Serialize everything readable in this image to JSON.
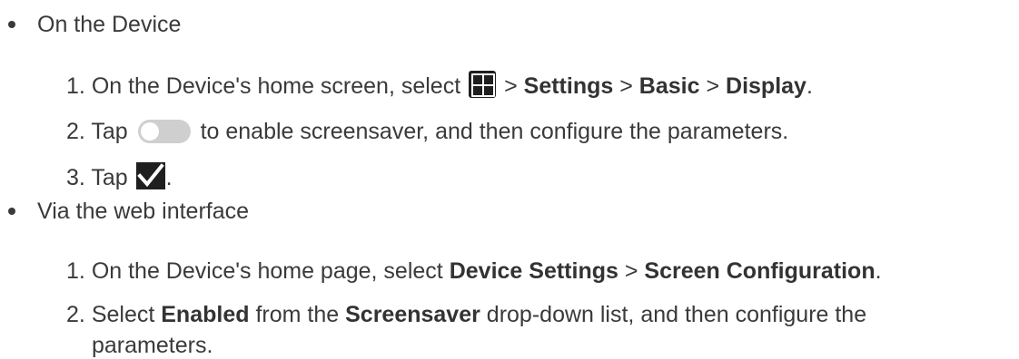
{
  "sections": [
    {
      "heading": "On the Device",
      "steps": [
        {
          "num": "1.",
          "pre": "On the Device's home screen, select",
          "sep1": ">",
          "b1": "Settings",
          "sep2": ">",
          "b2": "Basic",
          "sep3": ">",
          "b3": "Display",
          "end": "."
        },
        {
          "num": "2.",
          "pre": "Tap",
          "post": "to enable screensaver, and then configure the parameters."
        },
        {
          "num": "3.",
          "pre": "Tap",
          "end": "."
        }
      ]
    },
    {
      "heading": "Via the web interface",
      "steps": [
        {
          "num": "1.",
          "pre": "On the Device's home page, select",
          "b1": "Device Settings",
          "sep1": ">",
          "b2": "Screen Configuration",
          "end": "."
        },
        {
          "num": "2.",
          "pre": "Select",
          "b1": "Enabled",
          "mid": "from the",
          "b2": "Screensaver",
          "post": "drop-down list, and then configure the",
          "cont": "parameters."
        }
      ]
    }
  ],
  "icons": {
    "apps": "apps-grid-icon",
    "toggle": "toggle-switch-icon",
    "check": "checkmark-icon"
  }
}
